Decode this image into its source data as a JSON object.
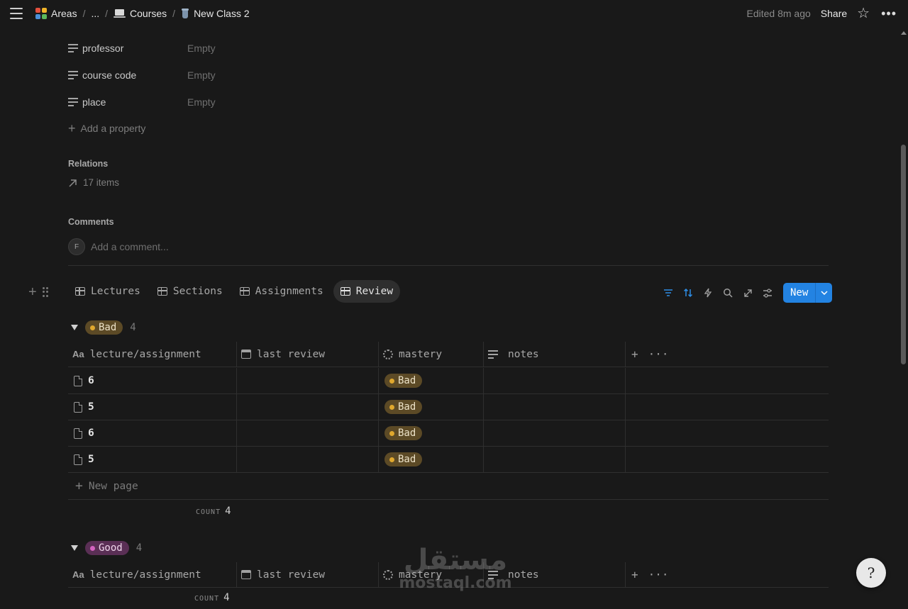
{
  "breadcrumb": {
    "items": [
      {
        "label": "Areas",
        "icon": "areas-icon"
      },
      {
        "label": "...",
        "icon": ""
      },
      {
        "label": "Courses",
        "icon": "laptop-icon"
      },
      {
        "label": "New Class 2",
        "icon": "cup-icon"
      }
    ],
    "separator": "/"
  },
  "topbar": {
    "edited": "Edited 8m ago",
    "share": "Share"
  },
  "properties": [
    {
      "name": "professor",
      "value": "Empty"
    },
    {
      "name": "course code",
      "value": "Empty"
    },
    {
      "name": "place",
      "value": "Empty"
    }
  ],
  "add_property": "Add a property",
  "relations": {
    "title": "Relations",
    "items": "17 items"
  },
  "comments": {
    "title": "Comments",
    "avatar": "F",
    "placeholder": "Add a comment..."
  },
  "tabs": [
    {
      "label": "Lectures",
      "active": false
    },
    {
      "label": "Sections",
      "active": false
    },
    {
      "label": "Assignments",
      "active": false
    },
    {
      "label": "Review",
      "active": true
    }
  ],
  "toolbar": {
    "new_label": "New",
    "accent": "#2383e2"
  },
  "columns": [
    "lecture/assignment",
    "last review",
    "mastery",
    "notes"
  ],
  "groups": [
    {
      "label": "Bad",
      "count": "4",
      "color": "#e0a82e",
      "rows": [
        {
          "title": "6",
          "last_review": "",
          "mastery": "Bad",
          "notes": ""
        },
        {
          "title": "5",
          "last_review": "",
          "mastery": "Bad",
          "notes": ""
        },
        {
          "title": "6",
          "last_review": "",
          "mastery": "Bad",
          "notes": ""
        },
        {
          "title": "5",
          "last_review": "",
          "mastery": "Bad",
          "notes": ""
        }
      ],
      "new_page": "New page",
      "footer": {
        "label": "COUNT",
        "value": "4"
      }
    },
    {
      "label": "Good",
      "count": "4",
      "color": "#d463c0",
      "rows": [],
      "footer": {
        "label": "COUNT",
        "value": "4"
      }
    }
  ],
  "watermark": {
    "arabic": "مستقل",
    "latin": "mostaql.com"
  }
}
